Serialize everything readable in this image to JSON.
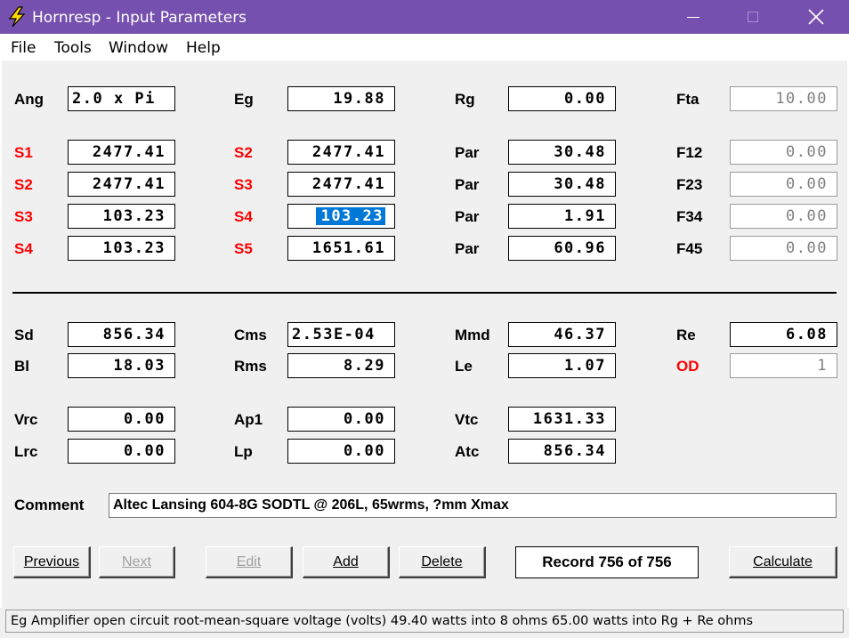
{
  "window": {
    "title": "Hornresp - Input Parameters",
    "accent_color": "#7650ae",
    "icon": "lightning-bolt-icon"
  },
  "menu": [
    "File",
    "Tools",
    "Window",
    "Help"
  ],
  "row0": [
    {
      "label": "Ang",
      "value": "2.0 x Pi"
    },
    {
      "label": "Eg",
      "value": "19.88"
    },
    {
      "label": "Rg",
      "value": "0.00"
    },
    {
      "label": "Fta",
      "value": "10.00"
    }
  ],
  "segments": [
    [
      {
        "label": "S1",
        "value": "2477.41"
      },
      {
        "label": "S2",
        "value": "2477.41"
      },
      {
        "label": "Par",
        "value": "30.48"
      },
      {
        "label": "F12",
        "value": "0.00"
      }
    ],
    [
      {
        "label": "S2",
        "value": "2477.41"
      },
      {
        "label": "S3",
        "value": "2477.41"
      },
      {
        "label": "Par",
        "value": "30.48"
      },
      {
        "label": "F23",
        "value": "0.00"
      }
    ],
    [
      {
        "label": "S3",
        "value": "103.23"
      },
      {
        "label": "S4",
        "value": "103.23"
      },
      {
        "label": "Par",
        "value": "1.91"
      },
      {
        "label": "F34",
        "value": "0.00"
      }
    ],
    [
      {
        "label": "S4",
        "value": "103.23"
      },
      {
        "label": "S5",
        "value": "1651.61"
      },
      {
        "label": "Par",
        "value": "60.96"
      },
      {
        "label": "F45",
        "value": "0.00"
      }
    ]
  ],
  "driver": [
    [
      {
        "label": "Sd",
        "value": "856.34"
      },
      {
        "label": "Cms",
        "value": "2.53E-04"
      },
      {
        "label": "Mmd",
        "value": "46.37"
      },
      {
        "label": "Re",
        "value": "6.08"
      }
    ],
    [
      {
        "label": "Bl",
        "value": "18.03"
      },
      {
        "label": "Rms",
        "value": "8.29"
      },
      {
        "label": "Le",
        "value": "1.07"
      },
      {
        "label": "OD",
        "value": "1"
      }
    ]
  ],
  "chamber": [
    [
      {
        "label": "Vrc",
        "value": "0.00"
      },
      {
        "label": "Ap1",
        "value": "0.00"
      },
      {
        "label": "Vtc",
        "value": "1631.33"
      }
    ],
    [
      {
        "label": "Lrc",
        "value": "0.00"
      },
      {
        "label": "Lp",
        "value": "0.00"
      },
      {
        "label": "Atc",
        "value": "856.34"
      }
    ]
  ],
  "comment": {
    "label": "Comment",
    "value": "Altec Lansing 604-8G SODTL @ 206L, 65wrms, ?mm Xmax"
  },
  "buttons": {
    "previous": "Previous",
    "next": "Next",
    "edit": "Edit",
    "add": "Add",
    "delete": "Delete",
    "calculate": "Calculate"
  },
  "record": "Record 756 of 756",
  "status": "Eg  Amplifier open circuit root-mean-square voltage  (volts)   49.40 watts into 8 ohms   65.00 watts into Rg + Re ohms"
}
